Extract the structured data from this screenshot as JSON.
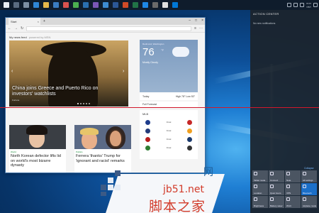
{
  "browser": {
    "tab_label": "Start",
    "feed_header": "My news feed",
    "feed_sub": "powered by MSN",
    "hero": {
      "title": "China joins Greece and Puerto Rico on investors' watchlists",
      "source": "Fortune"
    },
    "weather": {
      "location": "Redmond, Washington",
      "temp": "76",
      "unit": "°F",
      "condition": "Mostly Cloudy",
      "period": "Today",
      "hilo": "High 78° Low 53°",
      "forecast_label": "Full Forecast"
    },
    "scores": {
      "header": "MLB",
      "rows": [
        {
          "left": "Final",
          "right": "Final"
        },
        {
          "left": "Final",
          "right": "Final"
        },
        {
          "left": "Final",
          "right": "Final"
        },
        {
          "left": "Final",
          "right": "Final"
        }
      ]
    },
    "cards": [
      {
        "source": "World",
        "title": "North Korean defector lifts lid on world's most bizarre dynasty"
      },
      {
        "source": "Politics",
        "title": "Ferrera 'thanks' Trump for 'ignorant and racist' remarks"
      }
    ]
  },
  "action_center": {
    "title": "ACTION CENTER",
    "empty_text": "No new notifications",
    "collapse_label": "Collapse",
    "tiles": [
      {
        "label": "Tablet mode",
        "on": false
      },
      {
        "label": "Connect",
        "on": false
      },
      {
        "label": "Note",
        "on": false
      },
      {
        "label": "All settings",
        "on": false
      },
      {
        "label": "Location",
        "on": false
      },
      {
        "label": "Quiet hours",
        "on": false
      },
      {
        "label": "VPN",
        "on": false
      },
      {
        "label": "Bluetooth",
        "on": true
      },
      {
        "label": "Brightness",
        "on": false
      },
      {
        "label": "Battery saver",
        "on": false
      },
      {
        "label": "Wi-Fi",
        "on": false
      },
      {
        "label": "Airplane mode",
        "on": false
      }
    ]
  },
  "watermark": {
    "url": "jb51.net",
    "cn": "脚本之家",
    "mark": "网"
  },
  "colors": {
    "accent_line": "#d2182b",
    "tile_on": "#1b6fc8",
    "watermark": "#d23b2a"
  }
}
